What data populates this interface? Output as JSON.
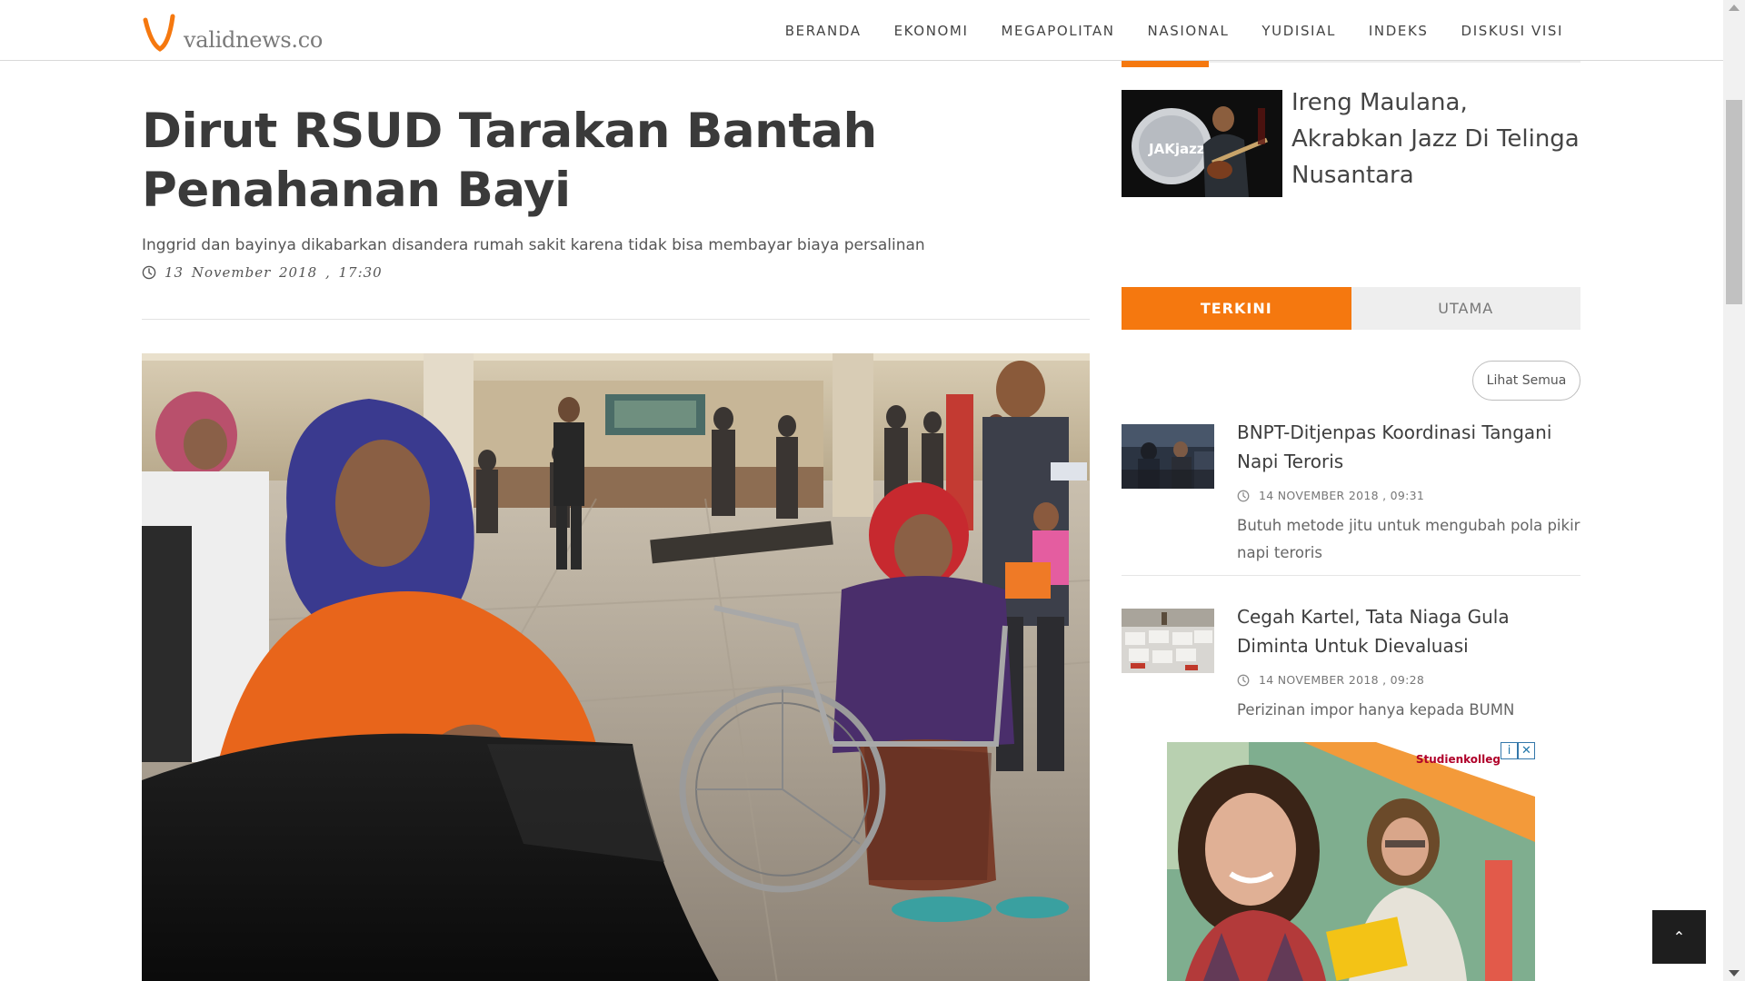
{
  "brand": {
    "logo_text": "validnews.co",
    "accent_color": "#f5780f"
  },
  "nav": {
    "items": [
      "BERANDA",
      "EKONOMI",
      "MEGAPOLITAN",
      "NASIONAL",
      "YUDISIAL",
      "INDEKS",
      "DISKUSI VISI"
    ]
  },
  "article": {
    "title": "Dirut RSUD Tarakan Bantah Penahanan Bayi",
    "subtitle": "Inggrid dan bayinya dikabarkan disandera rumah sakit karena tidak bisa membayar biaya persalinan",
    "date": "13 November 2018 , 17:30",
    "icons": {
      "clock": "clock-icon"
    }
  },
  "sidebar": {
    "featured": {
      "title": "Ireng Maulana, Akrabkan Jazz Di Telinga Nusantara",
      "thumb_badge": "JAKjazz"
    },
    "tabs": [
      "TERKINI",
      "UTAMA"
    ],
    "active_tab": "TERKINI",
    "see_all_label": "Lihat Semua",
    "news": [
      {
        "title": "BNPT-Ditjenpas Koordinasi Tangani Napi Teroris",
        "time": "14 NOVEMBER 2018 , 09:31",
        "desc": "Butuh metode jitu untuk mengubah pola pikir napi teroris"
      },
      {
        "title": "Cegah Kartel, Tata Niaga Gula Diminta Untuk Dievaluasi",
        "time": "14 NOVEMBER 2018 , 09:28",
        "desc": "Perizinan impor hanya kepada BUMN"
      }
    ]
  },
  "ad": {
    "brand_text": "Studienkolleg",
    "close_glyph": "✕",
    "info_glyph": "i"
  },
  "ui": {
    "back_to_top_glyph": "⌃"
  }
}
